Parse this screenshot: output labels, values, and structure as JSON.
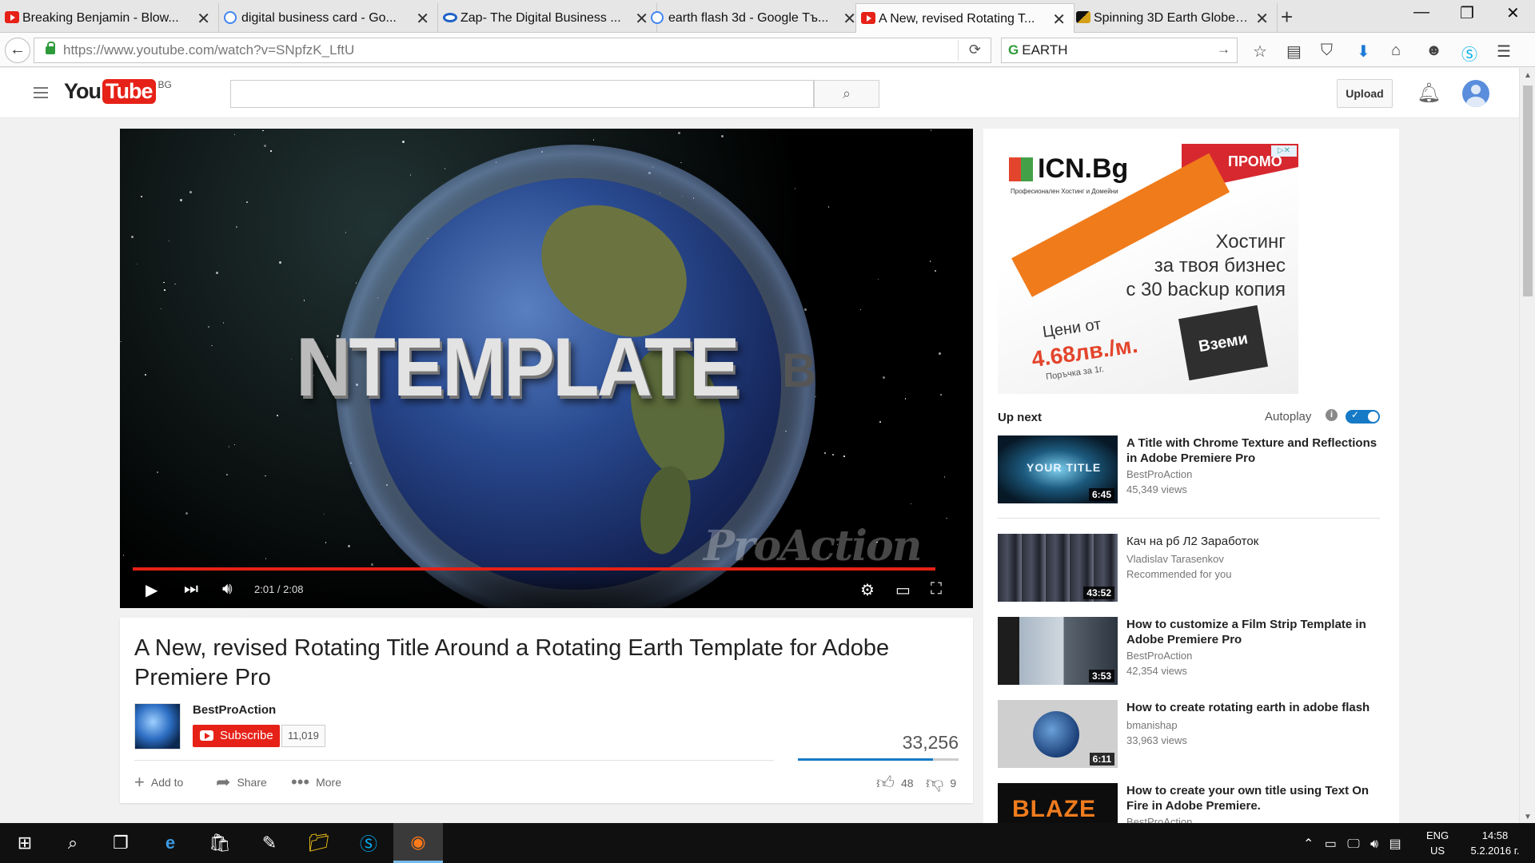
{
  "browser": {
    "tabs": [
      {
        "title": "Breaking Benjamin - Blow...",
        "favicon": "youtube-icon"
      },
      {
        "title": "digital business card - Go...",
        "favicon": "google-icon"
      },
      {
        "title": "Zap- The Digital Business ...",
        "favicon": "zap-icon"
      },
      {
        "title": "earth flash 3d - Google Тъ...",
        "favicon": "google-icon"
      },
      {
        "title": "A New, revised Rotating T...",
        "favicon": "youtube-icon"
      },
      {
        "title": "Spinning 3D Earth Globes ...",
        "favicon": "site-icon"
      }
    ],
    "active_tab": 4,
    "url_host": "https://www.youtube.com",
    "url_path": "/watch?v=SNpfzK_LftU",
    "search_value": "EARTH"
  },
  "youtube": {
    "logo_you": "You",
    "logo_tube": "Tube",
    "logo_country": "BG",
    "search_placeholder": "",
    "upload_label": "Upload"
  },
  "player": {
    "overlay_title_text": "TEMPLATE",
    "overlay_left_fragment": "N",
    "overlay_right_fragment": "B",
    "watermark": "ProAction",
    "time": "2:01 / 2:08",
    "progress_fraction": 0.97
  },
  "video": {
    "title": "A New, revised Rotating Title Around a Rotating Earth Template for Adobe Premiere Pro",
    "channel": "BestProAction",
    "subscribe_label": "Subscribe",
    "subscriber_count": "11,019",
    "views": "33,256",
    "likes": "48",
    "dislikes": "9",
    "like_fraction": 0.84,
    "actions": {
      "add_to": "Add to",
      "share": "Share",
      "more": "More"
    }
  },
  "ad": {
    "brand": "ICN.Bg",
    "tagline": "Професионален Хостинг и Домейни",
    "promo": "ПРОМО",
    "headline_1": "Хостинг",
    "headline_2": "за твоя бизнес",
    "headline_3": "с 30 backup копия",
    "price_label": "Цени от",
    "price": "4.68лв./м.",
    "price_note": "Поръчка за 1г.",
    "cta": "Вземи"
  },
  "sidebar": {
    "up_next": "Up next",
    "autoplay": "Autoplay",
    "autoplay_on": true,
    "items": [
      {
        "title": "A Title with Chrome Texture and Reflections in Adobe Premiere Pro",
        "channel": "BestProAction",
        "meta": "45,349 views",
        "duration": "6:45",
        "thumb_text": "YOUR TITLE"
      },
      {
        "title": "Кач на рб Л2 Заработок",
        "channel": "Vladislav Tarasenkov",
        "meta": "Recommended for you",
        "duration": "43:52"
      },
      {
        "title": "How to customize a Film Strip Template in Adobe Premiere Pro",
        "channel": "BestProAction",
        "meta": "42,354 views",
        "duration": "3:53"
      },
      {
        "title": "How to create rotating earth in adobe flash",
        "channel": "bmanishap",
        "meta": "33,963 views",
        "duration": "6:11"
      },
      {
        "title": "How to create your own title using Text On Fire in Adobe Premiere.",
        "channel": "BestProAction",
        "meta": "",
        "duration": "",
        "thumb_text": "BLAZE"
      }
    ]
  },
  "taskbar": {
    "language": "ENG",
    "region": "US",
    "time": "14:58",
    "date": "5.2.2016 г."
  }
}
